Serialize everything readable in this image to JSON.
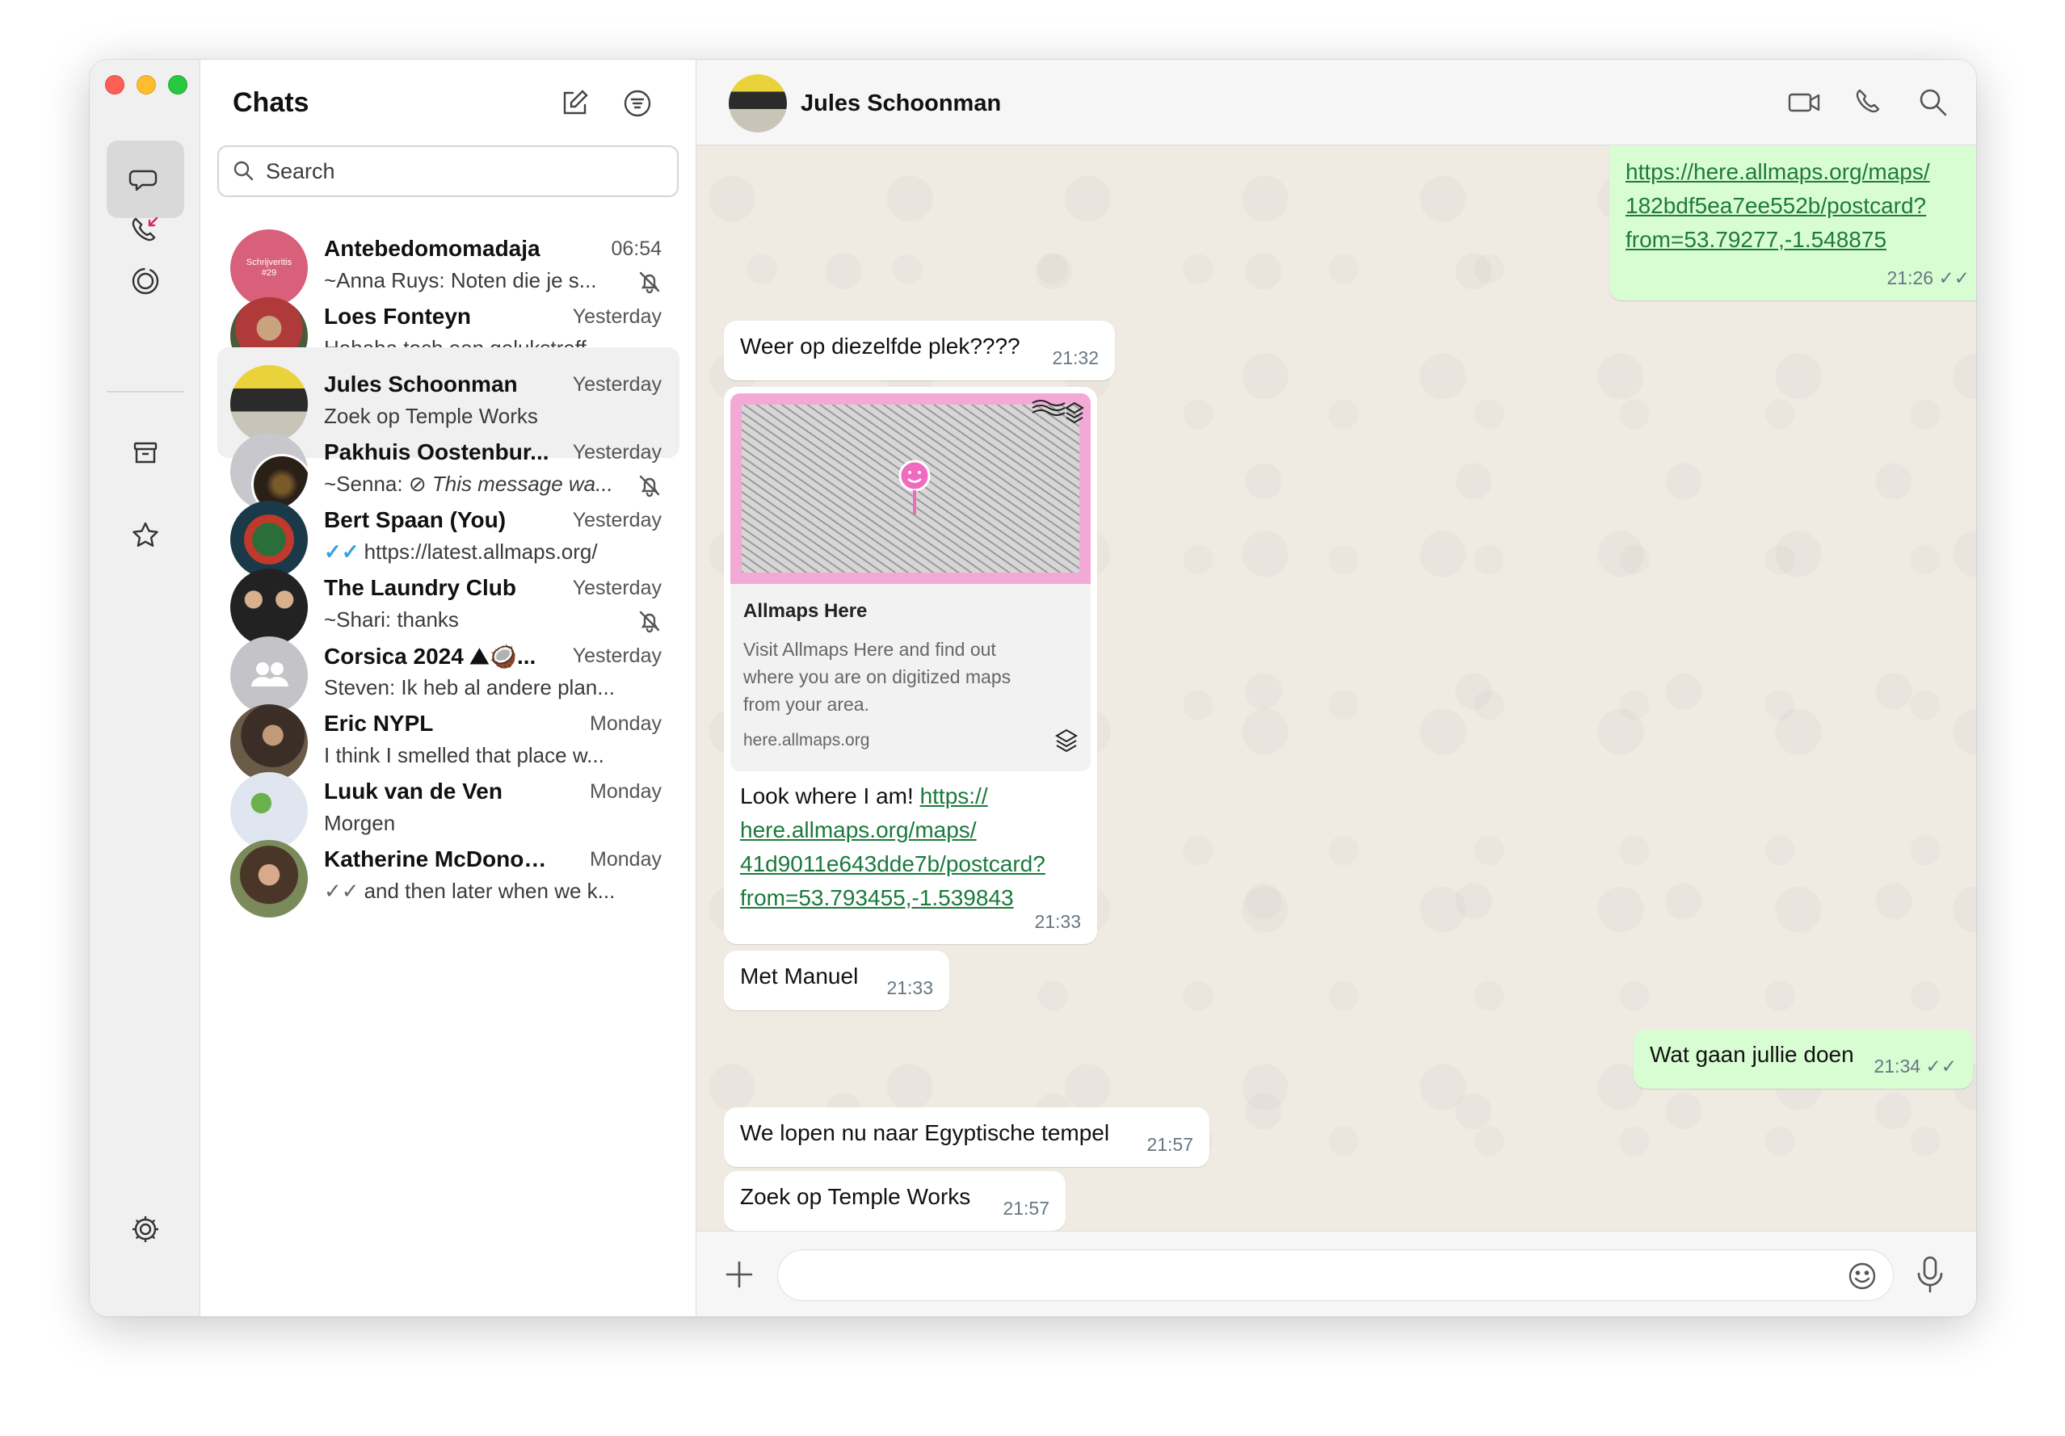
{
  "chat_list": {
    "title": "Chats",
    "search_placeholder": "Search",
    "items": [
      {
        "name": "Antebedomomadaja",
        "time": "06:54",
        "prefix": "~Anna Ruys: ",
        "preview": "Noten die je s...",
        "muted": true,
        "avatar_text": "Schrijveritis #29"
      },
      {
        "name": "Loes Fonteyn",
        "time": "Yesterday",
        "prefix": "",
        "preview": "Hahaha toch een gelukstreff..."
      },
      {
        "name": "Jules Schoonman",
        "time": "Yesterday",
        "prefix": "",
        "preview": "Zoek op Temple Works",
        "selected": true
      },
      {
        "name": "Pakhuis Oostenbur...",
        "time": "Yesterday",
        "prefix": "~Senna: ",
        "preview": "This message wa...",
        "muted": true
      },
      {
        "name": "Bert Spaan (You)",
        "time": "Yesterday",
        "prefix": "",
        "preview": "https://latest.allmaps.org/",
        "ticks": "✓✓"
      },
      {
        "name": "The Laundry Club",
        "time": "Yesterday",
        "prefix": "~Shari: ",
        "preview": "thanks",
        "muted": true
      },
      {
        "name": "Corsica 2024 ⛰🥥...",
        "time": "Yesterday",
        "prefix": "Steven: ",
        "preview": "Ik heb al andere plan..."
      },
      {
        "name": "Eric NYPL",
        "time": "Monday",
        "prefix": "",
        "preview": "I think I smelled that place w..."
      },
      {
        "name": "Luuk van de Ven",
        "time": "Monday",
        "prefix": "",
        "preview": "Morgen"
      },
      {
        "name": "Katherine McDonough",
        "time": "Monday",
        "prefix": "",
        "preview": "and then later when we k...",
        "ticks": "✓✓"
      }
    ]
  },
  "conversation": {
    "contact_name": "Jules Schoonman",
    "messages": [
      {
        "dir": "out",
        "link_lines": [
          "https://here.allmaps.org/maps/",
          "182bdf5ea7ee552b/postcard?",
          "from=53.79277,-1.548875"
        ],
        "time": "21:26",
        "ticks": "✓✓"
      },
      {
        "dir": "in",
        "text": "Weer op diezelfde plek????",
        "time": "21:32"
      },
      {
        "dir": "in",
        "preview_title": "Allmaps Here",
        "preview_desc_lines": [
          "Visit Allmaps Here and find out",
          "where you are on digitized maps",
          "from your area."
        ],
        "preview_domain": "here.allmaps.org",
        "text": "Look where I am! ",
        "link_lines": [
          "https://",
          "here.allmaps.org/maps/",
          "41d9011e643dde7b/postcard?",
          "from=53.793455,-1.539843"
        ],
        "time": "21:33"
      },
      {
        "dir": "in",
        "text": "Met Manuel",
        "time": "21:33"
      },
      {
        "dir": "out",
        "text": "Wat gaan jullie doen",
        "time": "21:34",
        "ticks": "✓✓"
      },
      {
        "dir": "in",
        "text": "We lopen nu naar Egyptische tempel",
        "time": "21:57"
      },
      {
        "dir": "in",
        "text": "Zoek op Temple Works",
        "time": "21:57"
      }
    ]
  },
  "colors": {
    "outgoing_bubble": "#d9fdd3",
    "incoming_bubble": "#ffffff",
    "chat_background": "#efeae2",
    "link": "#1f7a3e",
    "read_ticks": "#34a2e0",
    "postcard_pink": "#f3a9d6"
  }
}
